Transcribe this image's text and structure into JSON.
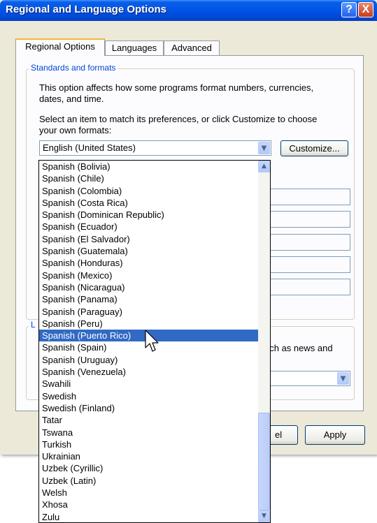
{
  "window": {
    "title": "Regional and Language Options",
    "help_glyph": "?",
    "close_glyph": "X"
  },
  "tabs": [
    {
      "label": "Regional Options",
      "active": true
    },
    {
      "label": "Languages",
      "active": false
    },
    {
      "label": "Advanced",
      "active": false
    }
  ],
  "standards": {
    "group_title": "Standards and formats",
    "desc_line1": "This option affects how some programs format numbers, currencies,",
    "desc_line2": "dates, and time.",
    "select_line1": "Select an item to match its preferences, or click Customize to choose",
    "select_line2": "your own formats:",
    "selected_value": "English (United States)",
    "customize_label": "Customize..."
  },
  "location": {
    "group_title_fragment": "L",
    "desc_fragment": "uch as news and"
  },
  "buttons": {
    "cancel_fragment": "el",
    "apply_label": "Apply"
  },
  "dropdown": {
    "items": [
      "Spanish (Bolivia)",
      "Spanish (Chile)",
      "Spanish (Colombia)",
      "Spanish (Costa Rica)",
      "Spanish (Dominican Republic)",
      "Spanish (Ecuador)",
      "Spanish (El Salvador)",
      "Spanish (Guatemala)",
      "Spanish (Honduras)",
      "Spanish (Mexico)",
      "Spanish (Nicaragua)",
      "Spanish (Panama)",
      "Spanish (Paraguay)",
      "Spanish (Peru)",
      "Spanish (Puerto Rico)",
      "Spanish (Spain)",
      "Spanish (Uruguay)",
      "Spanish (Venezuela)",
      "Swahili",
      "Swedish",
      "Swedish (Finland)",
      "Tatar",
      "Tswana",
      "Turkish",
      "Ukrainian",
      "Uzbek (Cyrillic)",
      "Uzbek (Latin)",
      "Welsh",
      "Xhosa",
      "Zulu"
    ],
    "highlighted_item": "Spanish (Puerto Rico)",
    "scroll_position": 1.0
  },
  "colors": {
    "titlebar": "#0055e5",
    "dialog_bg": "#ece9d8",
    "selection": "#316ac5",
    "group_title": "#0046d5",
    "active_tab_accent": "#f2b83b"
  }
}
